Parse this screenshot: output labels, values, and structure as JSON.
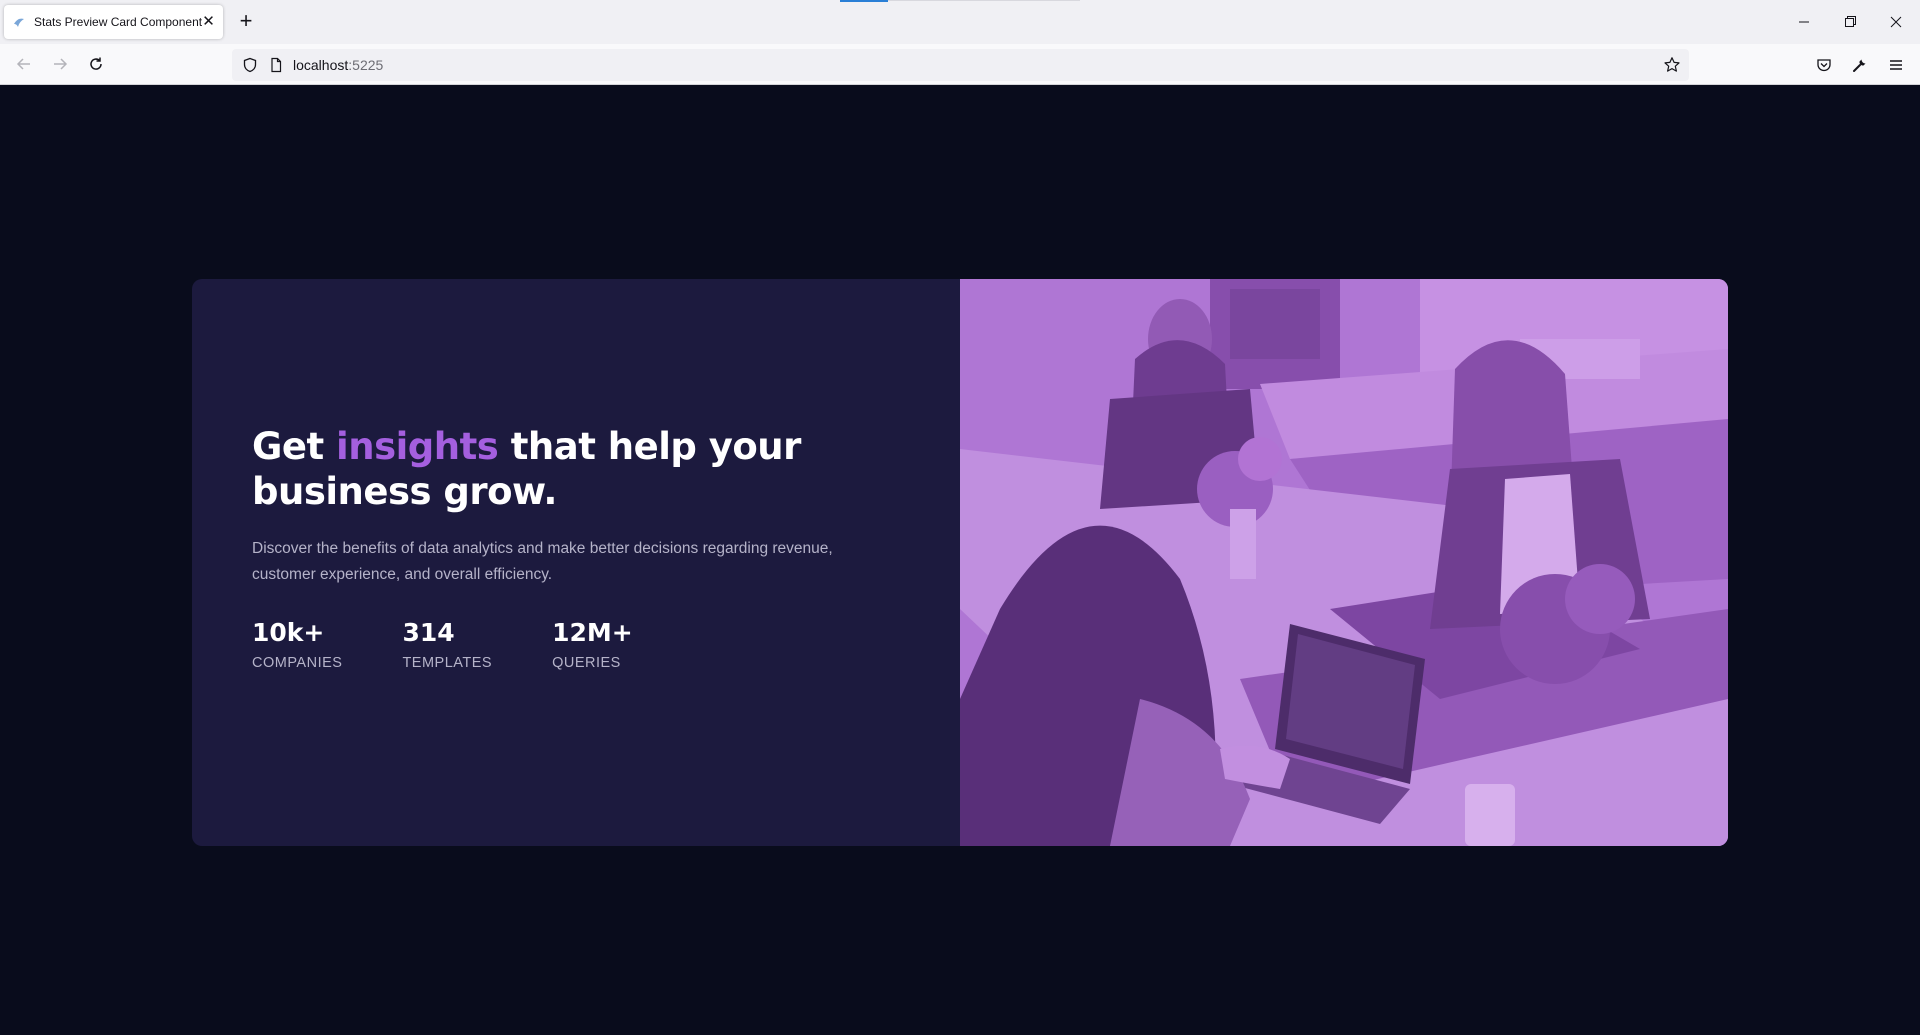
{
  "browser": {
    "tab_title": "Stats Preview Card Component",
    "url_host": "localhost",
    "url_port": ":5225",
    "icons": {
      "favicon": "favicon-icon",
      "tab_close": "close-icon",
      "new_tab": "plus-icon",
      "back": "arrow-left-icon",
      "forward": "arrow-right-icon",
      "reload": "reload-icon",
      "tracking": "shield-icon",
      "page_info": "page-icon",
      "bookmark": "star-icon",
      "pocket": "pocket-icon",
      "devtools": "wrench-icon",
      "menu": "hamburger-menu-icon",
      "minimize": "minimize-icon",
      "restore": "restore-icon",
      "close_window": "close-window-icon"
    }
  },
  "card": {
    "heading_before": "Get ",
    "heading_accent": "insights",
    "heading_after": " that help your business grow.",
    "description": "Discover the benefits of data analytics and make better decisions regarding revenue, customer experience, and overall efficiency.",
    "stats": [
      {
        "value": "10k+",
        "label": "COMPANIES"
      },
      {
        "value": "314",
        "label": "TEMPLATES"
      },
      {
        "value": "12M+",
        "label": "QUERIES"
      }
    ],
    "colors": {
      "page_background": "#090c1c",
      "card_background": "#1c1a3e",
      "accent": "#a45fdf",
      "image_overlay": "#aa5cdb",
      "text_primary": "#ffffff",
      "text_secondary": "#b5b3c9"
    }
  }
}
